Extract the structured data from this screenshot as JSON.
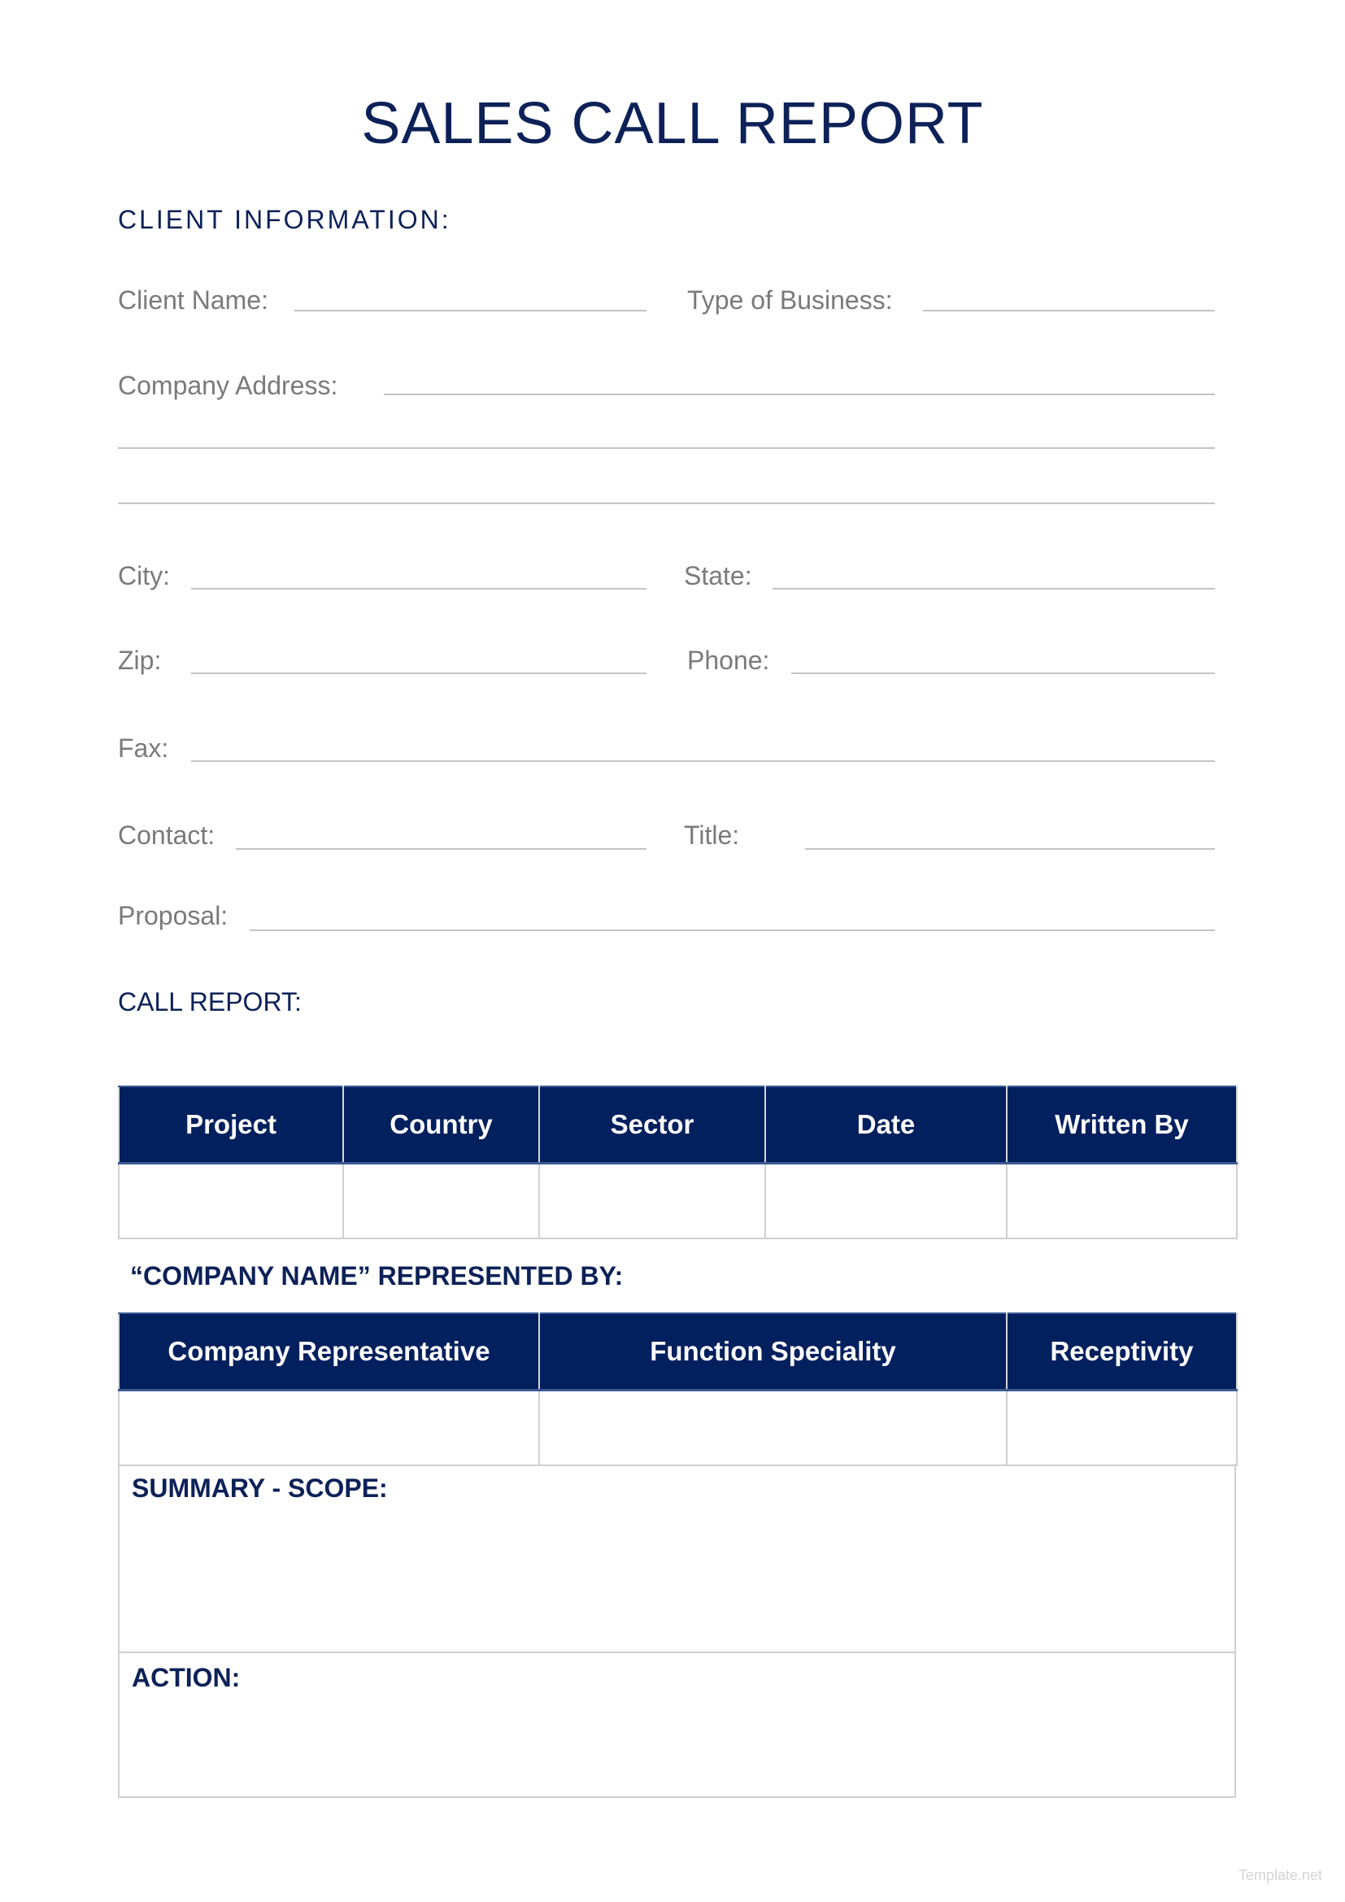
{
  "document": {
    "title": "SALES CALL REPORT",
    "accent_color": "#03205e",
    "client_information": {
      "heading": "CLIENT INFORMATION:",
      "fields": {
        "client_name": {
          "label": "Client Name:",
          "value": ""
        },
        "type_of_business": {
          "label": "Type of Business:",
          "value": ""
        },
        "company_address": {
          "label": "Company Address:",
          "value": ""
        },
        "city": {
          "label": "City:",
          "value": ""
        },
        "state": {
          "label": "State:",
          "value": ""
        },
        "zip": {
          "label": "Zip:",
          "value": ""
        },
        "phone": {
          "label": "Phone:",
          "value": ""
        },
        "fax": {
          "label": "Fax:",
          "value": ""
        },
        "contact": {
          "label": "Contact:",
          "value": ""
        },
        "title": {
          "label": "Title:",
          "value": ""
        },
        "proposal": {
          "label": "Proposal:",
          "value": ""
        }
      }
    },
    "call_report": {
      "heading": "CALL REPORT:",
      "columns": [
        "Project",
        "Country",
        "Sector",
        "Date",
        "Written By"
      ],
      "rows": [
        [
          "",
          "",
          "",
          "",
          ""
        ]
      ]
    },
    "represented_by": {
      "heading": "“COMPANY NAME” REPRESENTED BY:",
      "columns": [
        "Company Representative",
        "Function Speciality",
        "Receptivity"
      ],
      "rows": [
        [
          "",
          "",
          ""
        ]
      ]
    },
    "summary": {
      "label": "SUMMARY - SCOPE:",
      "value": ""
    },
    "action": {
      "label": "ACTION:",
      "value": ""
    },
    "watermark": "Template.net"
  }
}
